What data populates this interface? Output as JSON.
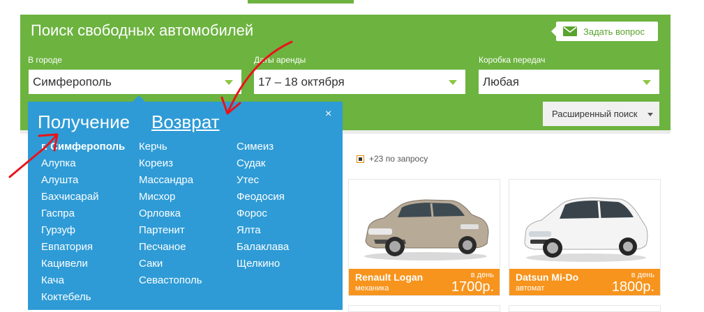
{
  "panel": {
    "title": "Поиск свободных автомобилей",
    "ask_button": "Задать вопрос",
    "city_label": "В городе",
    "city_value": "Симферополь",
    "dates_label": "Даты аренды",
    "dates_value": "17 – 18 октября",
    "gearbox_label": "Коробка передач",
    "gearbox_value": "Любая",
    "advanced_search": "Расширенный поиск"
  },
  "filter": {
    "label": "+23 по запросу"
  },
  "dropdown": {
    "tab_pickup": "Получение",
    "tab_return": "Возврат",
    "close": "×",
    "columns": [
      [
        "г. Симферополь",
        "Алупка",
        "Алушта",
        "Бахчисарай",
        "Гаспра",
        "Гурзуф",
        "Евпатория",
        "Кацивели",
        "Кача",
        "Коктебель"
      ],
      [
        "Керчь",
        "Кореиз",
        "Массандра",
        "Мисхор",
        "Орловка",
        "Партенит",
        "Песчаное",
        "Саки",
        "Севастополь"
      ],
      [
        "Симеиз",
        "Судак",
        "Утес",
        "Феодосия",
        "Форос",
        "Ялта",
        "Балаклава",
        "Щелкино"
      ]
    ]
  },
  "cars": [
    {
      "name": "Renault Logan",
      "transmission": "механика",
      "per_day": "в день",
      "price": "1700р."
    },
    {
      "name": "Datsun Mi-Do",
      "transmission": "автомат",
      "per_day": "в день",
      "price": "1800р."
    }
  ],
  "colors": {
    "panel_green": "#6cb33f",
    "dropdown_blue": "#2e9bd6",
    "price_orange": "#f7941d",
    "annotation_red": "#e8141b"
  }
}
